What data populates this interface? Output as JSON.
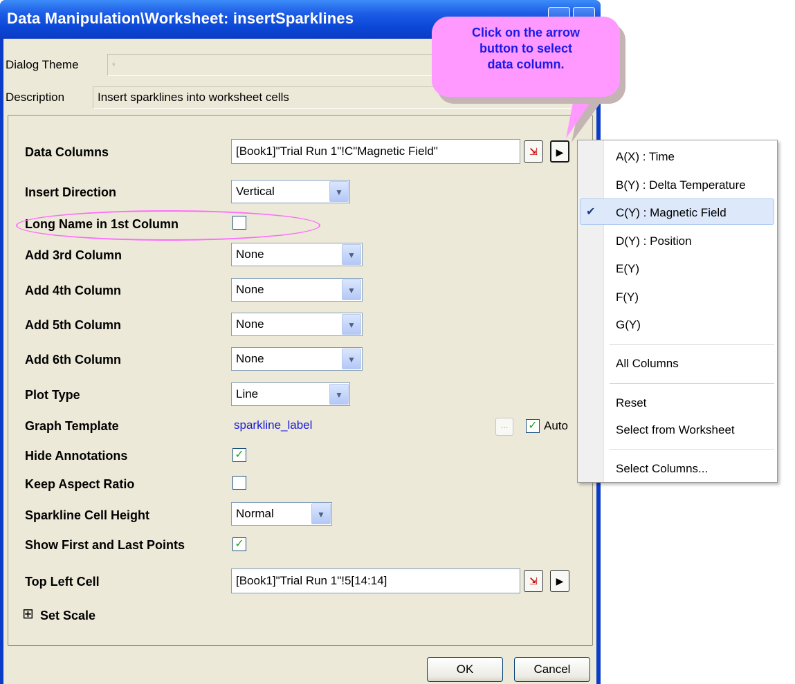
{
  "window": {
    "title": "Data Manipulation\\Worksheet: insertSparklines"
  },
  "header": {
    "dialog_theme_label": "Dialog Theme",
    "dialog_theme_value": "*",
    "description_label": "Description",
    "description_value": "Insert sparklines into worksheet cells"
  },
  "form": {
    "data_columns": {
      "label": "Data Columns",
      "value": "[Book1]\"Trial Run 1\"!C\"Magnetic Field\""
    },
    "insert_direction": {
      "label": "Insert Direction",
      "value": "Vertical"
    },
    "long_name": {
      "label": "Long Name in 1st Column",
      "checked": false
    },
    "add3": {
      "label": "Add 3rd Column",
      "value": "None"
    },
    "add4": {
      "label": "Add 4th Column",
      "value": "None"
    },
    "add5": {
      "label": "Add 5th Column",
      "value": "None"
    },
    "add6": {
      "label": "Add 6th Column",
      "value": "None"
    },
    "plot_type": {
      "label": "Plot Type",
      "value": "Line"
    },
    "graph_template": {
      "label": "Graph Template",
      "value": "sparkline_label",
      "ellipsis": "...",
      "auto_label": "Auto",
      "auto_checked": true
    },
    "hide_annotations": {
      "label": "Hide Annotations",
      "checked": true
    },
    "keep_aspect": {
      "label": "Keep Aspect Ratio",
      "checked": false
    },
    "cell_height": {
      "label": "Sparkline Cell Height",
      "value": "Normal"
    },
    "first_last": {
      "label": "Show First and Last Points",
      "checked": true
    },
    "top_left": {
      "label": "Top Left Cell",
      "value": "[Book1]\"Trial Run 1\"!5[14:14]"
    },
    "set_scale": {
      "label": "Set Scale",
      "expander": "⊞"
    }
  },
  "buttons": {
    "ok": "OK",
    "cancel": "Cancel"
  },
  "menu": {
    "items": [
      {
        "label": "A(X) : Time"
      },
      {
        "label": "B(Y) : Delta Temperature"
      },
      {
        "label": "C(Y) : Magnetic Field",
        "selected": true,
        "check": "✔"
      },
      {
        "label": "D(Y) : Position"
      },
      {
        "label": "E(Y)"
      },
      {
        "label": "F(Y)"
      },
      {
        "label": "G(Y)"
      },
      {
        "label": "All Columns"
      },
      {
        "label": "Reset"
      },
      {
        "label": "Select from Worksheet"
      },
      {
        "label": "Select Columns..."
      }
    ]
  },
  "callout": {
    "line1": "Click on the arrow",
    "line2": "button to select",
    "line3": "data column.",
    "color": "#ff99ff",
    "text_color": "#1a1ae6"
  },
  "colors": {
    "titlebar": "#0b47d6",
    "dialog_bg": "#ece9d8",
    "highlight_ellipse": "#ff6bff"
  }
}
